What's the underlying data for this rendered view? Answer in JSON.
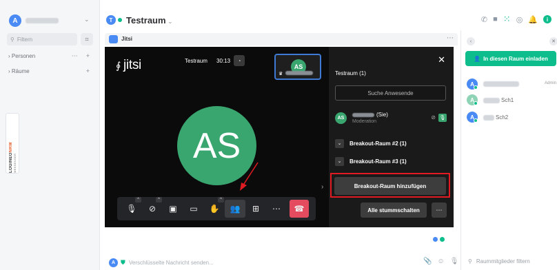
{
  "colors": {
    "accent_green": "#0dbd8b",
    "avatar_blue": "#4a8af4",
    "jitsi_avatar_green": "#3aa66f",
    "highlight_red": "#e11b22",
    "hangup_red": "#e54b5f"
  },
  "user": {
    "avatar_letter": "A"
  },
  "sidebar": {
    "search_placeholder": "Filtern",
    "sections": [
      {
        "label": "Personen"
      },
      {
        "label": "Räume"
      }
    ],
    "widget": {
      "brand_a": "LOGINEO",
      "brand_b": "NRW",
      "sub": "MESSENGER"
    }
  },
  "header": {
    "room_avatar": "T",
    "room_name": "Testraum"
  },
  "widget": {
    "title": "Jitsi"
  },
  "jitsi": {
    "logo": "jitsi",
    "meeting_name": "Testraum",
    "timer": "30:13",
    "thumb_initials": "AS",
    "main_initials": "AS",
    "participants_title": "Testraum (1)",
    "search_label": "Suche Anwesende",
    "me": {
      "initials": "AS",
      "suffix": "(Sie)",
      "role": "Moderation"
    },
    "breakout_rooms": [
      {
        "label": "Breakout-Raum #2 (1)"
      },
      {
        "label": "Breakout-Raum #3 (1)"
      }
    ],
    "add_breakout_label": "Breakout-Raum hinzufügen",
    "mute_all_label": "Alle stummschalten",
    "more_label": "⋯"
  },
  "composer": {
    "avatar_letter": "A",
    "placeholder": "Verschlüsselte Nachricht senden..."
  },
  "right_panel": {
    "invite_label": "In diesen Raum einladen",
    "members": [
      {
        "letter": "A",
        "name_suffix": "",
        "extra": "Admin"
      },
      {
        "letter": "A",
        "name_suffix": "Sch1",
        "extra": ""
      },
      {
        "letter": "A",
        "name_suffix": "Sch2",
        "extra": ""
      }
    ],
    "filter_placeholder": "Raummitglieder filtern"
  }
}
